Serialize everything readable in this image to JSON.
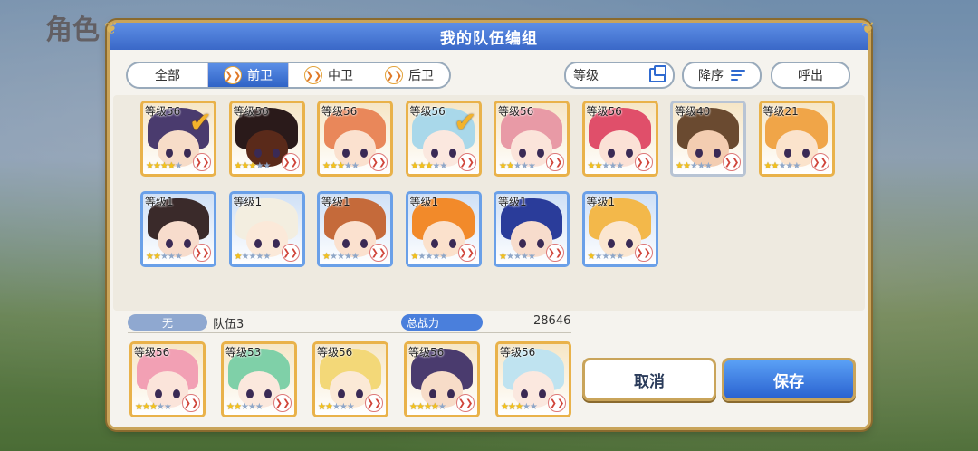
{
  "background": {
    "title": "角色"
  },
  "dialog": {
    "title": "我的队伍编组"
  },
  "tabs": [
    {
      "label": "全部",
      "active": false,
      "icon": ""
    },
    {
      "label": "前卫",
      "active": true,
      "icon": "chevron-icon"
    },
    {
      "label": "中卫",
      "active": false,
      "icon": "chevron-icon"
    },
    {
      "label": "后卫",
      "active": false,
      "icon": "chevron-icon"
    }
  ],
  "tools": {
    "level_label": "等级",
    "sort_label": "降序",
    "call_label": "呼出"
  },
  "roster": [
    {
      "level": "等级56",
      "stars": 4,
      "selected": true,
      "hair": "#4a3b6e",
      "skin": "#f7dcc8",
      "frame": "gold"
    },
    {
      "level": "等级56",
      "stars": 3,
      "selected": false,
      "hair": "#2a1a1a",
      "skin": "#5a2a1a",
      "frame": "gold"
    },
    {
      "level": "等级56",
      "stars": 3,
      "selected": false,
      "hair": "#e9875a",
      "skin": "#fbe1cf",
      "frame": "gold"
    },
    {
      "level": "等级56",
      "stars": 3,
      "selected": true,
      "hair": "#a9d8ea",
      "skin": "#fbe8df",
      "frame": "gold"
    },
    {
      "level": "等级56",
      "stars": 2,
      "selected": false,
      "hair": "#e89aa6",
      "skin": "#fbe4da",
      "frame": "gold"
    },
    {
      "level": "等级56",
      "stars": 2,
      "selected": false,
      "hair": "#e04f6a",
      "skin": "#fbe1d6",
      "frame": "gold"
    },
    {
      "level": "等级40",
      "stars": 2,
      "selected": false,
      "hair": "#6a4a30",
      "skin": "#f3cdb1",
      "frame": "silver"
    },
    {
      "level": "等级21",
      "stars": 2,
      "selected": false,
      "hair": "#f0a548",
      "skin": "#fbe3cc",
      "frame": "gold"
    },
    {
      "level": "等级1",
      "stars": 2,
      "selected": false,
      "hair": "#3a2a2a",
      "skin": "#f7dccc",
      "frame": "blue"
    },
    {
      "level": "等级1",
      "stars": 1,
      "selected": false,
      "hair": "#f3eee0",
      "skin": "#fbe9d9",
      "frame": "blue"
    },
    {
      "level": "等级1",
      "stars": 1,
      "selected": false,
      "hair": "#c56a3a",
      "skin": "#fbe1cf",
      "frame": "blue"
    },
    {
      "level": "等级1",
      "stars": 1,
      "selected": false,
      "hair": "#f28a2a",
      "skin": "#fbe1cc",
      "frame": "blue"
    },
    {
      "level": "等级1",
      "stars": 1,
      "selected": false,
      "hair": "#2a3c9a",
      "skin": "#f7dccc",
      "frame": "blue"
    },
    {
      "level": "等级1",
      "stars": 1,
      "selected": false,
      "hair": "#f3b84a",
      "skin": "#fbe6d0",
      "frame": "blue"
    }
  ],
  "team": {
    "guild_tag": "无",
    "name": "队伍3",
    "power_label": "总战力",
    "power_value": "28646",
    "members": [
      {
        "level": "等级56",
        "stars": 3,
        "hair": "#f2a0b4",
        "skin": "#fbe4da"
      },
      {
        "level": "等级53",
        "stars": 2,
        "hair": "#7fd0a8",
        "skin": "#fbe8dd"
      },
      {
        "level": "等级56",
        "stars": 2,
        "hair": "#f3d878",
        "skin": "#fbe9d6"
      },
      {
        "level": "等级56",
        "stars": 4,
        "hair": "#4a3b6e",
        "skin": "#f7dcc8"
      },
      {
        "level": "等级56",
        "stars": 3,
        "hair": "#bfe3f0",
        "skin": "#fbe8df"
      }
    ]
  },
  "buttons": {
    "cancel": "取消",
    "save": "保存"
  }
}
